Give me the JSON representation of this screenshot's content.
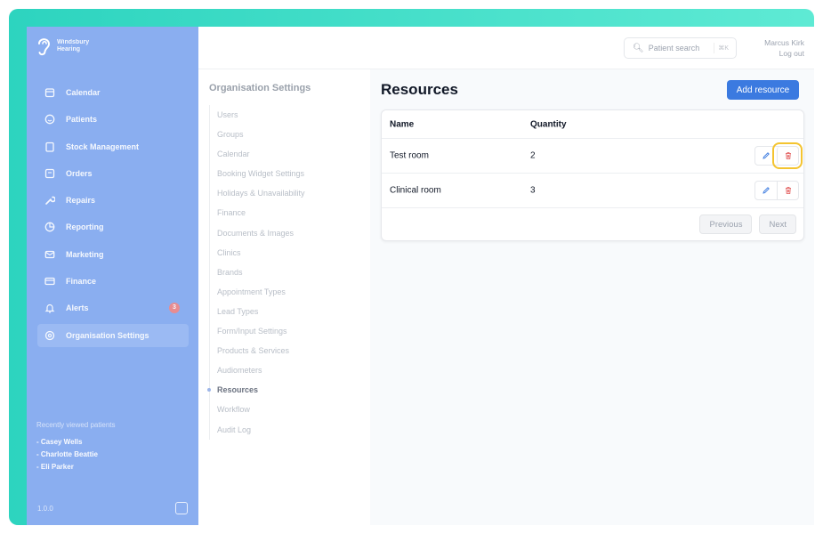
{
  "brand": {
    "name": "Windsbury\nHearing"
  },
  "sidebar": {
    "items": [
      {
        "label": "Calendar",
        "icon": "calendar-icon"
      },
      {
        "label": "Patients",
        "icon": "smile-icon"
      },
      {
        "label": "Stock Management",
        "icon": "clipboard-icon"
      },
      {
        "label": "Orders",
        "icon": "orders-icon"
      },
      {
        "label": "Repairs",
        "icon": "wrench-icon"
      },
      {
        "label": "Reporting",
        "icon": "chart-pie-icon"
      },
      {
        "label": "Marketing",
        "icon": "mail-icon"
      },
      {
        "label": "Finance",
        "icon": "credit-card-icon"
      },
      {
        "label": "Alerts",
        "icon": "bell-icon",
        "badge": "3"
      },
      {
        "label": "Organisation Settings",
        "icon": "gear-icon",
        "active": true
      }
    ],
    "recent_title": "Recently viewed patients",
    "recent": [
      "- Casey Wells",
      "- Charlotte Beattie",
      "- Eli Parker"
    ],
    "version": "1.0.0"
  },
  "topbar": {
    "search_label": "Patient search",
    "search_shortcut": "⌘K",
    "user_name": "Marcus Kirk",
    "logout": "Log out"
  },
  "settings": {
    "title": "Organisation Settings",
    "items": [
      "Users",
      "Groups",
      "Calendar",
      "Booking Widget Settings",
      "Holidays & Unavailability",
      "Finance",
      "Documents & Images",
      "Clinics",
      "Brands",
      "Appointment Types",
      "Lead Types",
      "Form/Input Settings",
      "Products & Services",
      "Audiometers",
      "Resources",
      "Workflow",
      "Audit Log"
    ],
    "current": "Resources"
  },
  "main": {
    "title": "Resources",
    "add_button": "Add resource",
    "columns": [
      "Name",
      "Quantity"
    ],
    "rows": [
      {
        "name": "Test room",
        "quantity": "2"
      },
      {
        "name": "Clinical room",
        "quantity": "3"
      }
    ],
    "prev": "Previous",
    "next": "Next"
  },
  "colors": {
    "sidebar": "#8aaef0",
    "accent": "#3b7ae0",
    "highlight": "#f4c430",
    "delete": "#e05252",
    "frame": "#2dd4bf"
  }
}
